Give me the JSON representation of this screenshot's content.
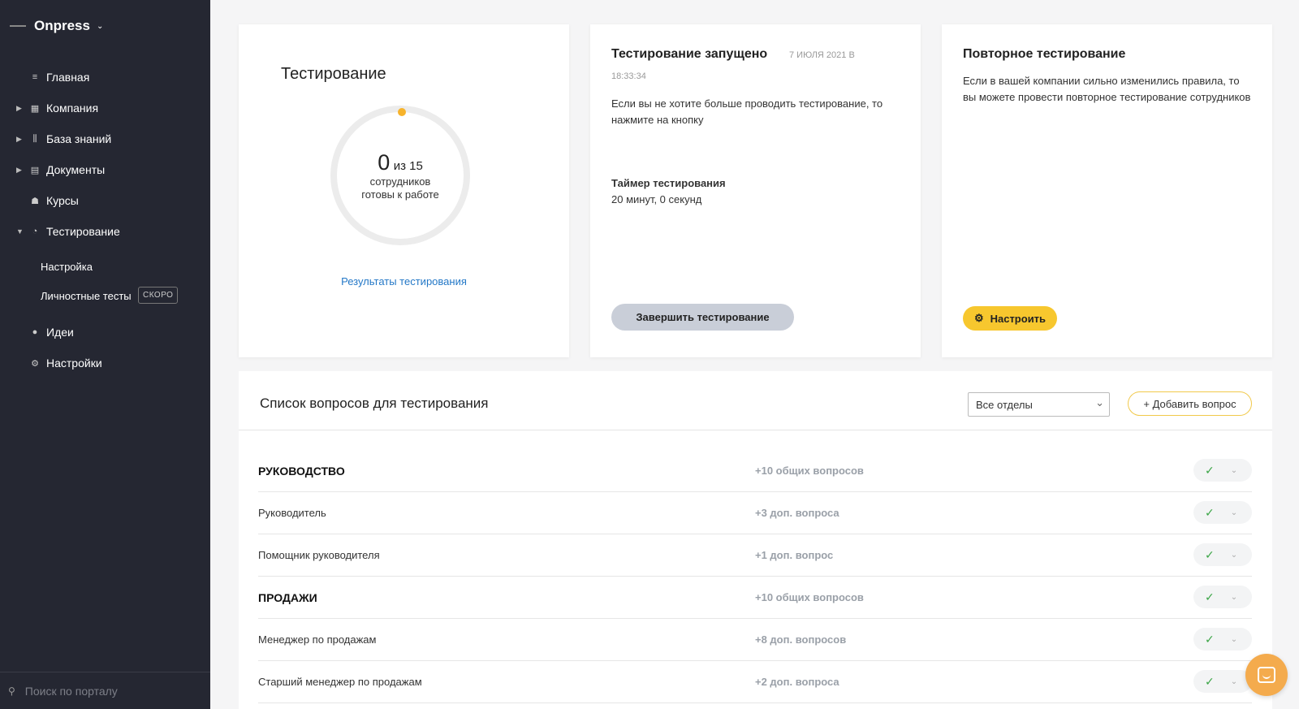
{
  "brand": {
    "name": "Onpress"
  },
  "nav": {
    "items": [
      {
        "label": "Главная",
        "icon": "list-icon",
        "glyph": "≡",
        "expand": ""
      },
      {
        "label": "Компания",
        "icon": "building-icon",
        "glyph": "▦",
        "expand": "▶"
      },
      {
        "label": "База знаний",
        "icon": "books-icon",
        "glyph": "⫼",
        "expand": "▶"
      },
      {
        "label": "Документы",
        "icon": "document-icon",
        "glyph": "▤",
        "expand": "▶"
      },
      {
        "label": "Курсы",
        "icon": "graduation-cap-icon",
        "glyph": "☗",
        "expand": ""
      },
      {
        "label": "Тестирование",
        "icon": "check-circle-icon",
        "glyph": "◔",
        "expand": "▼"
      }
    ],
    "sub_items": [
      {
        "label": "Настройка"
      },
      {
        "label": "Личностные тесты",
        "badge": "СКОРО"
      }
    ],
    "after_items": [
      {
        "label": "Идеи",
        "icon": "lightbulb-icon",
        "glyph": "●"
      },
      {
        "label": "Настройки",
        "icon": "gear-icon",
        "glyph": "⚙"
      }
    ]
  },
  "search": {
    "placeholder": "Поиск по порталу"
  },
  "test_card": {
    "title": "Тестирование",
    "ready_count": "0",
    "of_text": "из 15",
    "subtitle_line1": "сотрудников",
    "subtitle_line2": "готовы к работе",
    "results_link": "Результаты тестирования",
    "progress": 0
  },
  "run_card": {
    "title": "Тестирование запущено",
    "date": "7 ИЮЛЯ 2021 В",
    "time": "18:33:34",
    "description": "Если вы не хотите больше проводить тестирование, то нажмите на кнопку",
    "timer_label": "Таймер тестирования",
    "timer_value": "20 минут, 0 секунд",
    "button": "Завершить тестирование"
  },
  "retest_card": {
    "title": "Повторное тестирование",
    "description": "Если в вашей компании сильно изменились правила, то вы можете провести повторное тестирование сотрудников",
    "button": "Настроить"
  },
  "questions": {
    "title": "Список вопросов для тестирования",
    "department_select": "Все отделы",
    "add_button": "+ Добавить вопрос",
    "rows": [
      {
        "name": "РУКОВОДСТВО",
        "count": "+10 общих вопросов",
        "group": true
      },
      {
        "name": "Руководитель",
        "count": "+3 доп. вопроса",
        "group": false
      },
      {
        "name": "Помощник руководителя",
        "count": "+1 доп. вопрос",
        "group": false
      },
      {
        "name": "ПРОДАЖИ",
        "count": "+10 общих вопросов",
        "group": true
      },
      {
        "name": "Менеджер по продажам",
        "count": "+8 доп. вопросов",
        "group": false
      },
      {
        "name": "Старший менеджер по продажам",
        "count": "+2 доп. вопроса",
        "group": false
      }
    ]
  },
  "colors": {
    "sidebar_bg": "#252732",
    "accent_yellow": "#f7c72e",
    "link_blue": "#2478c7",
    "check_green": "#3aa545",
    "chat_orange": "#f4ab4d"
  }
}
